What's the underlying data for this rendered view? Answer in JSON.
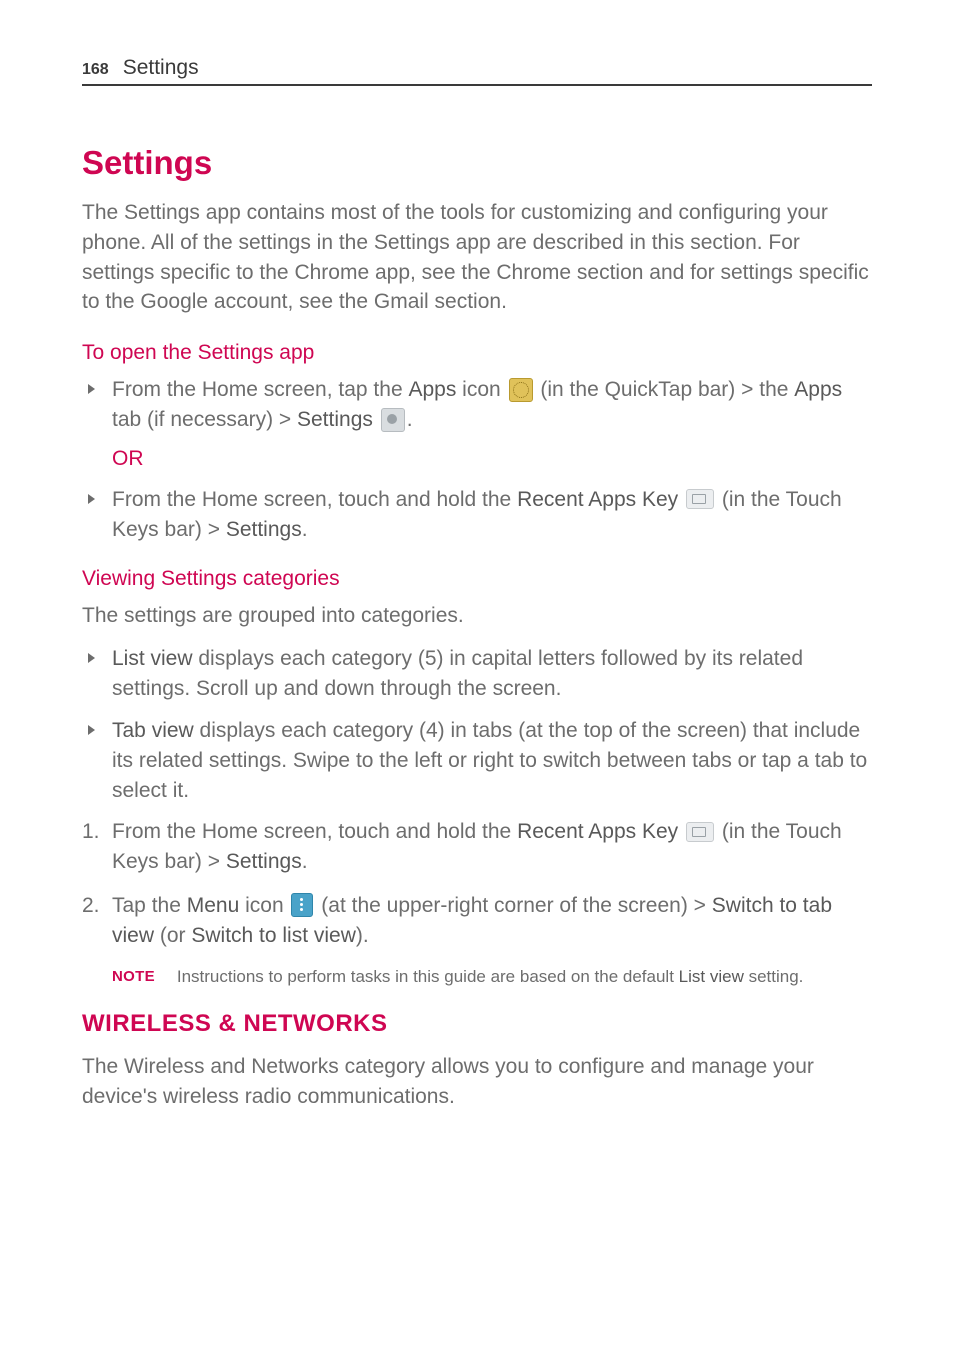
{
  "header": {
    "page_number": "168",
    "title": "Settings"
  },
  "main_title": "Settings",
  "intro_paragraph": "The Settings app contains most of the tools for customizing and configuring your phone. All of the settings in the Settings app are described in this section. For settings specific to the Chrome app, see the Chrome section and for settings specific to the Google account, see the Gmail section.",
  "open_settings": {
    "heading": "To open the Settings app",
    "bullet1": {
      "t1": "From the Home screen, tap the ",
      "b1": "Apps",
      "t2": " icon ",
      "t3": " (in the QuickTap bar) > the ",
      "b2": "Apps",
      "t4": " tab (if necessary) > ",
      "b3": "Settings",
      "t5": " ",
      "t6": "."
    },
    "or_label": "OR",
    "bullet2": {
      "t1": "From the Home screen, touch and hold the ",
      "b1": "Recent Apps Key",
      "t2": " ",
      "t3": " (in the Touch Keys bar) > ",
      "b2": "Settings",
      "t4": "."
    }
  },
  "viewing": {
    "heading": "Viewing Settings categories",
    "intro": "The settings are grouped into categories.",
    "bullet_list": {
      "b1": "List view",
      "t1": " displays each category (5) in capital letters followed by its related settings. Scroll up and down through the screen."
    },
    "bullet_tab": {
      "b1": "Tab view",
      "t1": " displays each category (4) in tabs (at the top of the screen) that include its related settings. Swipe to the left or right to switch between tabs or tap a tab to select it."
    },
    "step1": {
      "num": "1.",
      "t1": "From the Home screen, touch and hold the ",
      "b1": "Recent Apps Key",
      "t2": " ",
      "t3": " (in the Touch Keys bar) > ",
      "b2": "Settings",
      "t4": "."
    },
    "step2": {
      "num": "2.",
      "t1": "Tap the ",
      "b1": "Menu",
      "t2": " icon ",
      "t3": " (at the upper-right corner of the screen) > ",
      "b2": "Switch to tab view",
      "t4": " (or ",
      "b3": "Switch to list view",
      "t5": ")."
    },
    "note": {
      "label": "NOTE",
      "t1": "Instructions to perform tasks in this guide are based on the default ",
      "b1": "List view",
      "t2": " setting."
    }
  },
  "wireless": {
    "heading": "WIRELESS & NETWORKS",
    "paragraph": "The Wireless and Networks category allows you to configure and manage your device's wireless radio communications."
  }
}
